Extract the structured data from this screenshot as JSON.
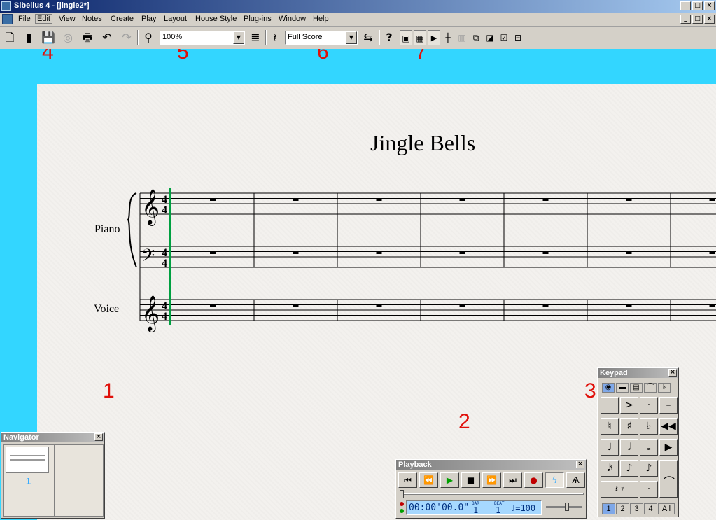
{
  "window": {
    "title": "Sibelius 4 - [jingle2*]",
    "minimize": "_",
    "maximize": "□",
    "close": "×"
  },
  "menu": [
    "File",
    "Edit",
    "View",
    "Notes",
    "Create",
    "Play",
    "Layout",
    "House Style",
    "Plug-ins",
    "Window",
    "Help"
  ],
  "toolbar": {
    "zoom": "100%",
    "view": "Full Score",
    "help": "?"
  },
  "score": {
    "title": "Jingle Bells",
    "instruments": [
      "Piano",
      "Voice"
    ],
    "time_signature": "4/4",
    "measures_visible": 7
  },
  "callouts": [
    "4",
    "5",
    "6",
    "7",
    "1",
    "2",
    "3"
  ],
  "navigator": {
    "title": "Navigator",
    "page": "1",
    "close": "×"
  },
  "playback": {
    "title": "Playback",
    "close": "×",
    "time": "00:00'00.0\"",
    "bar_label": "BAR",
    "bar": "1",
    "beat_label": "BEAT",
    "beat": "1",
    "tempo": "♩=100"
  },
  "keypad": {
    "title": "Keypad",
    "close": "×",
    "tabs": [
      "◉",
      "▬",
      "▤",
      "⌒",
      "♭"
    ],
    "keys": [
      "",
      ">",
      "·",
      "–",
      "♮",
      "♯",
      "♭",
      "◀◀",
      "♩",
      "𝅗𝅥",
      "𝅝",
      "▶",
      "𝅘𝅥𝅯",
      "♪",
      "♪",
      "",
      "𝄽 𝄾",
      "",
      "·",
      "⌒"
    ],
    "layouts": [
      "1",
      "2",
      "3",
      "4",
      "All"
    ]
  }
}
